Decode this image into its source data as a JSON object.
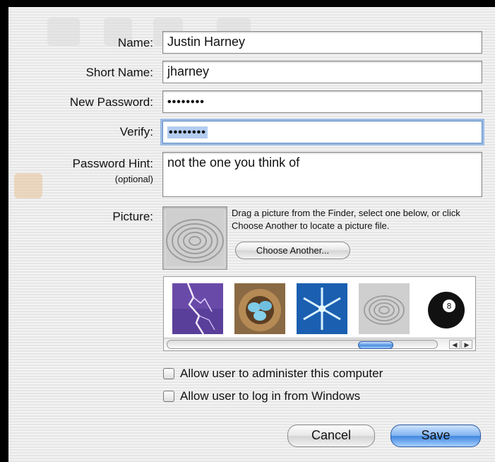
{
  "form": {
    "name_label": "Name:",
    "name_value": "Justin Harney",
    "short_name_label": "Short Name:",
    "short_name_value": "jharney",
    "new_password_label": "New Password:",
    "new_password_mask": "••••••••",
    "verify_label": "Verify:",
    "verify_mask": "••••••••",
    "hint_label": "Password Hint:",
    "hint_sublabel": "(optional)",
    "hint_value": "not the one you think of"
  },
  "picture": {
    "label": "Picture:",
    "help_text": "Drag a picture from the Finder, select one below, or click Choose Another to locate a picture file.",
    "choose_another_label": "Choose Another...",
    "current_picture": "zen-sand-spiral-icon",
    "thumbnails": [
      "lightning-icon",
      "bird-nest-eggs-icon",
      "snowflake-icon",
      "zen-sand-spiral-icon",
      "eight-ball-icon"
    ]
  },
  "options": {
    "admin_label": "Allow user to administer this computer",
    "admin_checked": false,
    "windows_label": "Allow user to log in from Windows",
    "windows_checked": false
  },
  "buttons": {
    "cancel_label": "Cancel",
    "save_label": "Save"
  },
  "colors": {
    "default_button": "#3f86df",
    "focus_ring": "#9cbbe4",
    "selection": "#b3cdf0"
  }
}
